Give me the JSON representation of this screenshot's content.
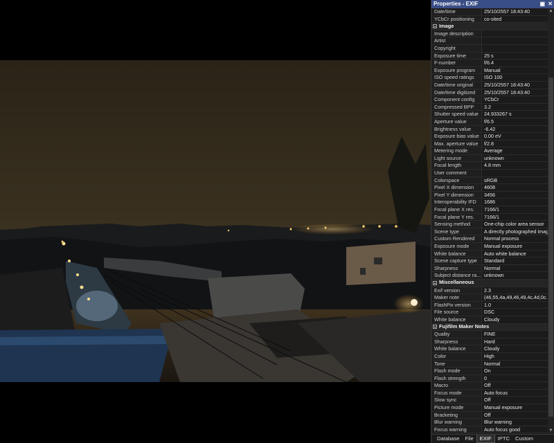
{
  "panel": {
    "title": "Properties - EXIF",
    "pin_icon": "pin-icon",
    "close_icon": "close-icon",
    "rows": [
      {
        "type": "row",
        "k": "Date/time",
        "v": "25/10/2557 18:43:40"
      },
      {
        "type": "row",
        "k": "YCbCr positioning",
        "v": "co-sited"
      },
      {
        "type": "sec",
        "label": "Image"
      },
      {
        "type": "row",
        "k": "Image description",
        "v": ""
      },
      {
        "type": "row",
        "k": "Artist",
        "v": ""
      },
      {
        "type": "row",
        "k": "Copyright",
        "v": ""
      },
      {
        "type": "row",
        "k": "Exposure time",
        "v": "25 s"
      },
      {
        "type": "row",
        "k": "F-number",
        "v": "f/6.4"
      },
      {
        "type": "row",
        "k": "Exposure program",
        "v": "Manual"
      },
      {
        "type": "row",
        "k": "ISO speed ratings",
        "v": "ISO 100"
      },
      {
        "type": "row",
        "k": "Date/time original",
        "v": "25/10/2557 18:43:40"
      },
      {
        "type": "row",
        "k": "Date/time digitized",
        "v": "25/10/2557 18:43:40"
      },
      {
        "type": "row",
        "k": "Component config",
        "v": "YCbCr"
      },
      {
        "type": "row",
        "k": "Compressed BPP",
        "v": "3.2"
      },
      {
        "type": "row",
        "k": "Shutter speed value",
        "v": "24.933267 s"
      },
      {
        "type": "row",
        "k": "Aperture value",
        "v": "f/6.5"
      },
      {
        "type": "row",
        "k": "Brightness value",
        "v": "-6.42"
      },
      {
        "type": "row",
        "k": "Exposure bias value",
        "v": "0.00 eV"
      },
      {
        "type": "row",
        "k": "Max. aperture value",
        "v": "f/2.8"
      },
      {
        "type": "row",
        "k": "Metering mode",
        "v": "Average"
      },
      {
        "type": "row",
        "k": "Light source",
        "v": "unknown"
      },
      {
        "type": "row",
        "k": "Focal length",
        "v": "4.8 mm"
      },
      {
        "type": "row",
        "k": "User comment",
        "v": ""
      },
      {
        "type": "row",
        "k": "Colorspace",
        "v": "sRGB"
      },
      {
        "type": "row",
        "k": "Pixel X dimension",
        "v": "4608"
      },
      {
        "type": "row",
        "k": "Pixel Y dimension",
        "v": "3456"
      },
      {
        "type": "row",
        "k": "Interoperability IFD",
        "v": "1686"
      },
      {
        "type": "row",
        "k": "Focal plane X res.",
        "v": "7166/1"
      },
      {
        "type": "row",
        "k": "Focal plane Y res.",
        "v": "7166/1"
      },
      {
        "type": "row",
        "k": "Sensing method",
        "v": "One-chip color area sensor"
      },
      {
        "type": "row",
        "k": "Scene type",
        "v": "A directly photographed image"
      },
      {
        "type": "row",
        "k": "Custom Rendered",
        "v": "Normal process"
      },
      {
        "type": "row",
        "k": "Exposure mode",
        "v": "Manual exposure"
      },
      {
        "type": "row",
        "k": "White balance",
        "v": "Auto white balance"
      },
      {
        "type": "row",
        "k": "Scene capture type",
        "v": "Standard"
      },
      {
        "type": "row",
        "k": "Sharpness",
        "v": "Normal"
      },
      {
        "type": "row",
        "k": "Subject distance ra...",
        "v": "unknown"
      },
      {
        "type": "sec",
        "label": "Miscellaneous"
      },
      {
        "type": "row",
        "k": "Exif version",
        "v": "2.3"
      },
      {
        "type": "row",
        "k": "Maker note",
        "v": "(46,55,4a,49,46,49,4c,4d,0c..."
      },
      {
        "type": "row",
        "k": "FlashPix version",
        "v": "1.0"
      },
      {
        "type": "row",
        "k": "File source",
        "v": "DSC"
      },
      {
        "type": "row",
        "k": "White balance",
        "v": "Cloudy"
      },
      {
        "type": "sec",
        "label": "Fujifilm Maker Notes"
      },
      {
        "type": "row",
        "k": "Quality",
        "v": "FINE"
      },
      {
        "type": "row",
        "k": "Sharpness",
        "v": "Hard"
      },
      {
        "type": "row",
        "k": "White balance",
        "v": "Cloudy"
      },
      {
        "type": "row",
        "k": "Color",
        "v": "High"
      },
      {
        "type": "row",
        "k": "Tone",
        "v": "Normal"
      },
      {
        "type": "row",
        "k": "Flash mode",
        "v": "On"
      },
      {
        "type": "row",
        "k": "Flash strength",
        "v": "0"
      },
      {
        "type": "row",
        "k": "Macro",
        "v": "Off"
      },
      {
        "type": "row",
        "k": "Focus mode",
        "v": "Auto focus"
      },
      {
        "type": "row",
        "k": "Slow sync",
        "v": "Off"
      },
      {
        "type": "row",
        "k": "Picture mode",
        "v": "Manual exposure"
      },
      {
        "type": "row",
        "k": "Bracketing",
        "v": "Off"
      },
      {
        "type": "row",
        "k": "Blur warning",
        "v": "Blur warning"
      },
      {
        "type": "row",
        "k": "Focus warning",
        "v": "Auto focus good"
      }
    ],
    "tabs": [
      {
        "label": "Database",
        "active": false
      },
      {
        "label": "File",
        "active": false
      },
      {
        "label": "EXIF",
        "active": true
      },
      {
        "label": "IPTC",
        "active": false
      },
      {
        "label": "Custom",
        "active": false
      }
    ]
  },
  "colors": {
    "titlebar": "#3a4e86",
    "panel_bg": "#1b1b1b",
    "sky": "#3b3220"
  }
}
